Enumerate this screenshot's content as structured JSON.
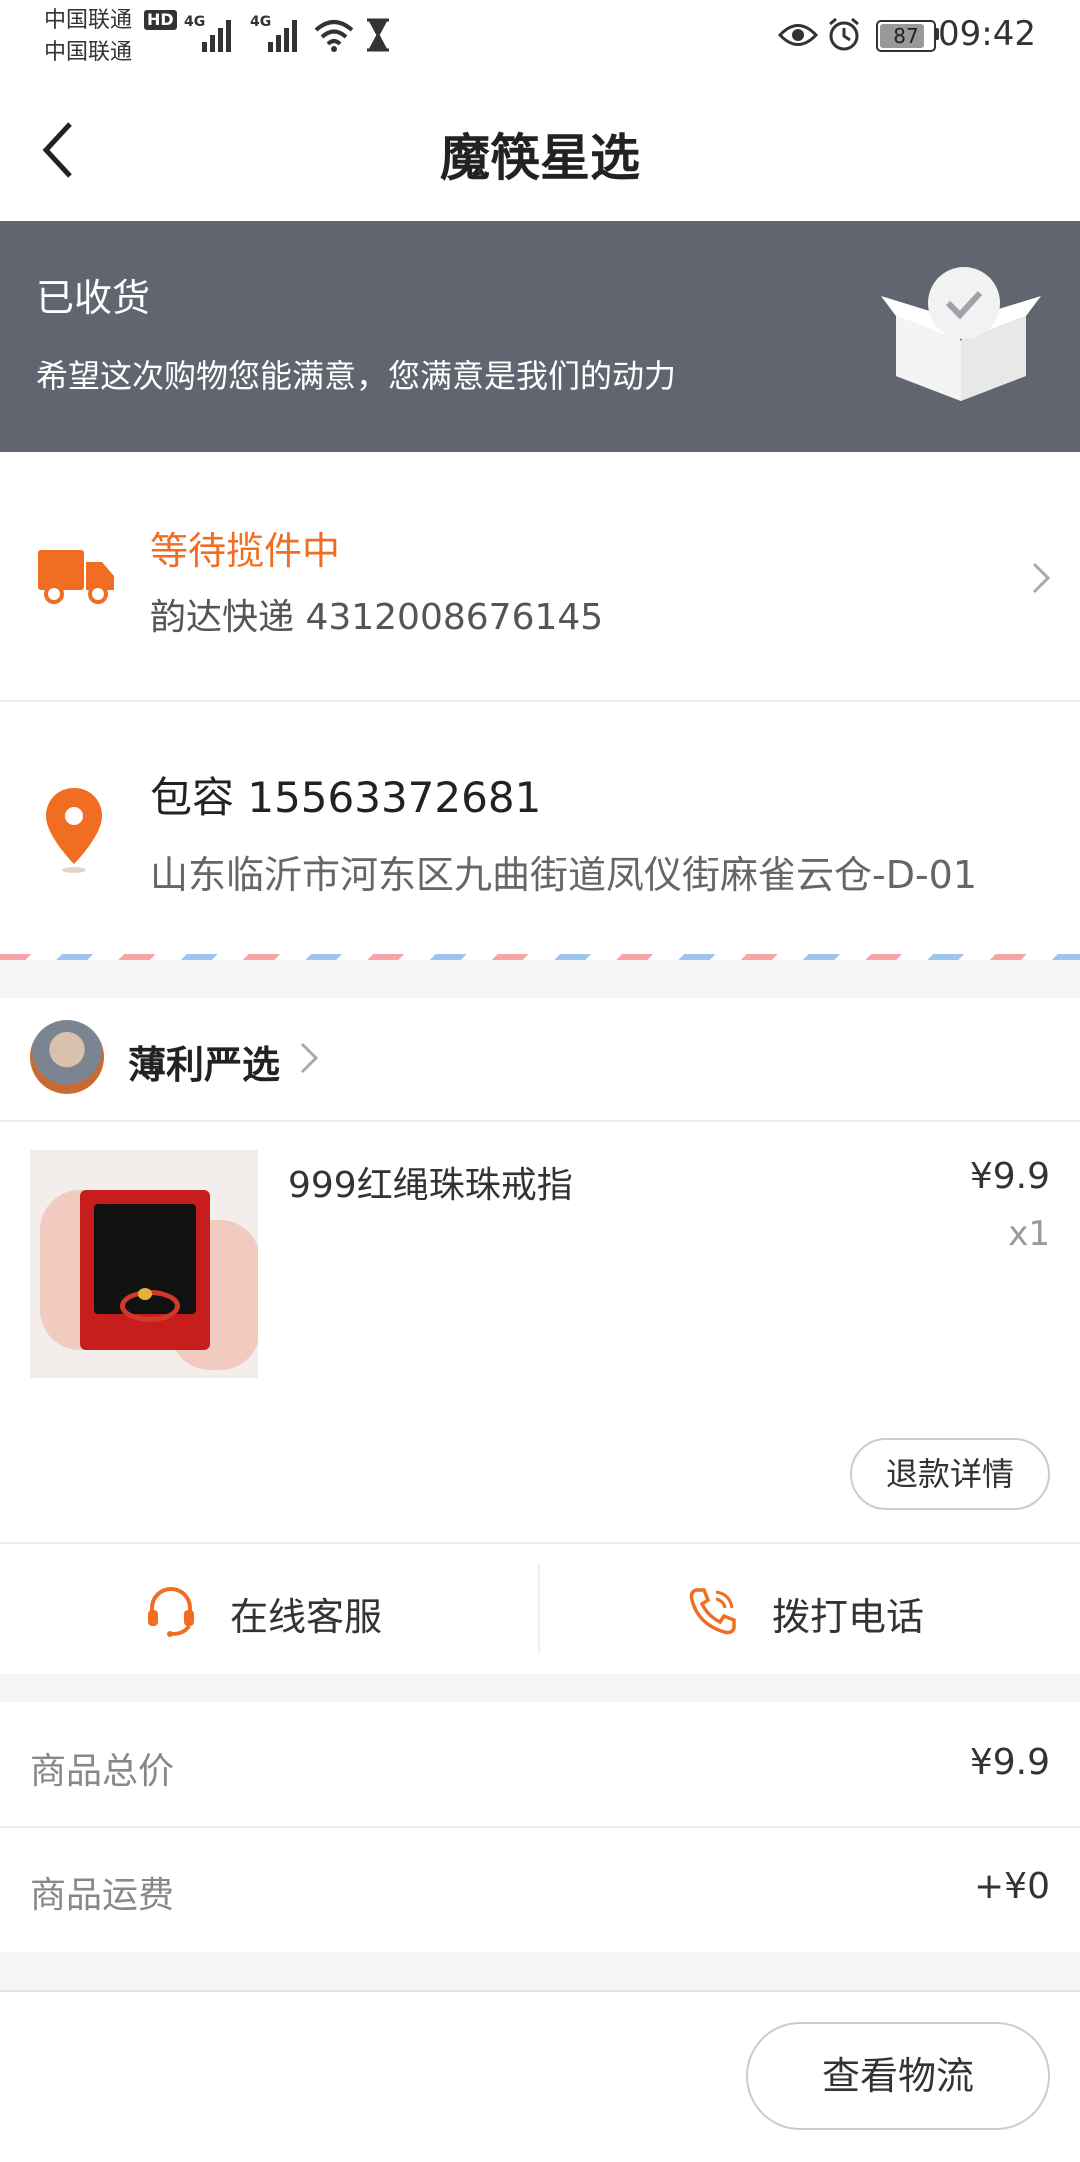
{
  "status_bar": {
    "carrier_1": "中国联通",
    "carrier_2": "中国联通",
    "hd": "HD",
    "network_1": "4G",
    "network_2": "4G",
    "battery": "87",
    "time": "09:42"
  },
  "header": {
    "title": "魔筷星选"
  },
  "banner": {
    "title": "已收货",
    "subtitle": "希望这次购物您能满意，您满意是我们的动力"
  },
  "logistics": {
    "status": "等待揽件中",
    "courier": "韵达快递 4312008676145"
  },
  "address": {
    "contact": "包容 15563372681",
    "detail": "山东临沂市河东区九曲街道凤仪街麻雀云仓-D-01"
  },
  "shop": {
    "name": "薄利严选"
  },
  "product": {
    "name": "999红绳珠珠戒指",
    "price": "¥9.9",
    "quantity": "x1",
    "refund_button": "退款详情"
  },
  "service": {
    "online_service": "在线客服",
    "call": "拨打电话"
  },
  "summary": {
    "total_label": "商品总价",
    "total_value": "¥9.9",
    "shipping_label": "商品运费",
    "shipping_value": "+¥0"
  },
  "footer": {
    "logistics_button": "查看物流"
  },
  "colors": {
    "accent": "#f06d22",
    "banner_bg": "#60656f"
  }
}
